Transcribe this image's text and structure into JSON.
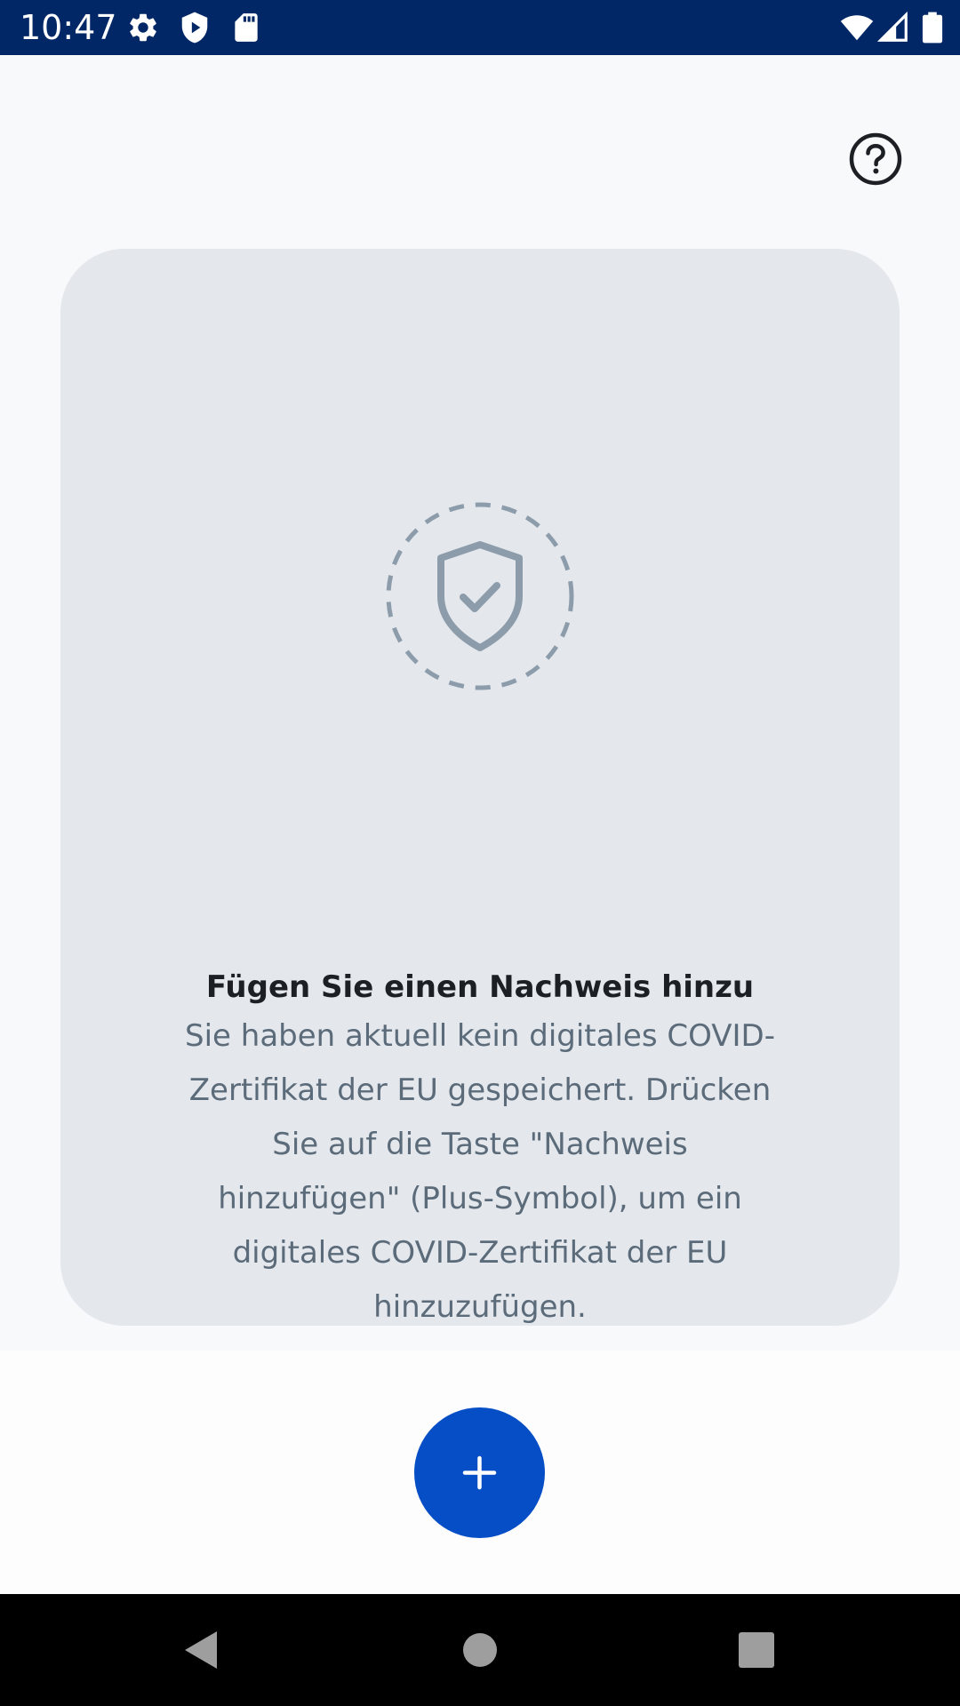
{
  "status_bar": {
    "time": "10:47",
    "left_icons": [
      "settings-icon",
      "shield-play-icon",
      "sd-card-icon"
    ],
    "right_icons": [
      "wifi-icon",
      "cell-signal-icon",
      "battery-icon"
    ],
    "background": "#012766"
  },
  "header": {
    "help_icon": "help-circle-icon"
  },
  "empty_state": {
    "icon": "shield-check-icon",
    "title": "Fügen Sie einen Nachweis hinzu",
    "body": "Sie haben aktuell kein digitales COVID-Zertifikat der EU gespeichert. Drücken Sie auf die Taste \"Nachweis hinzufügen\" (Plus-Symbol), um ein digitales COVID-Zertifikat der EU hinzuzufügen."
  },
  "fab": {
    "icon": "plus-icon",
    "color": "#064ec6"
  },
  "nav_bar": {
    "buttons": [
      "back-icon",
      "home-icon",
      "recents-icon"
    ]
  }
}
